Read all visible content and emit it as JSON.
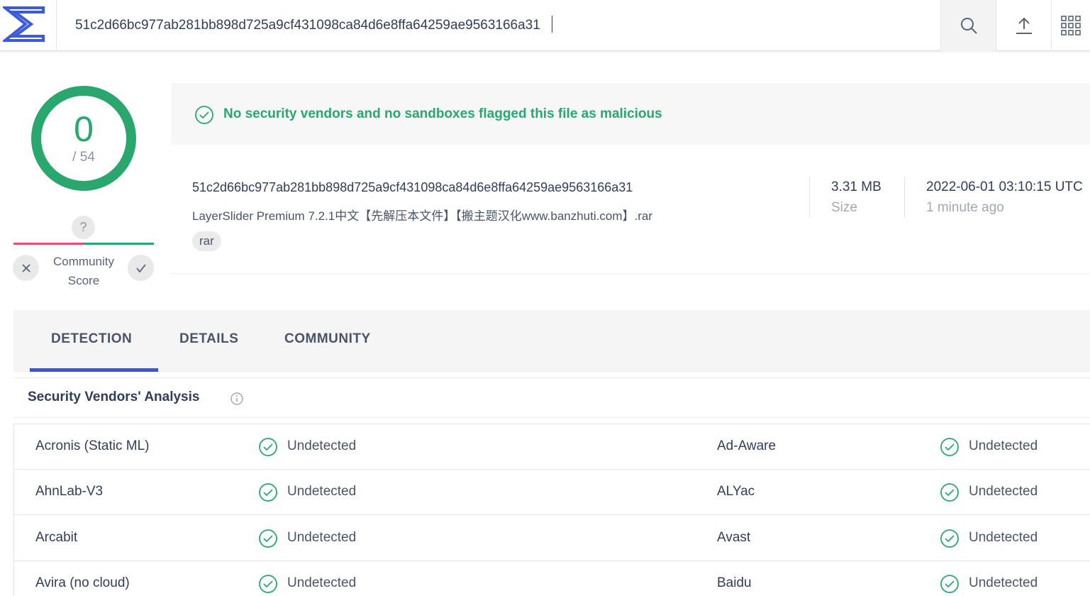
{
  "header": {
    "search_value": "51c2d66bc977ab281bb898d725a9cf431098ca84d6e8ffa64259ae9563166a31",
    "logo_icon": "virustotal-sigma-logo",
    "search_icon": "search-icon",
    "upload_icon": "upload-icon",
    "apps_icon": "apps-grid-icon"
  },
  "score": {
    "detections": "0",
    "total": "/ 54",
    "color": "#2aa76e"
  },
  "community": {
    "question": "?",
    "label_line1": "Community",
    "label_line2": "Score",
    "negative_color": "#e5506e",
    "positive_color": "#2aa76e"
  },
  "banner": {
    "message": "No security vendors and no sandboxes flagged this file as malicious",
    "color": "#2aa76e"
  },
  "file": {
    "hash": "51c2d66bc977ab281bb898d725a9cf431098ca84d6e8ffa64259ae9563166a31",
    "name": "LayerSlider Premium 7.2.1中文【先解压本文件】【搬主题汉化www.banzhuti.com】.rar",
    "tag": "rar",
    "size_value": "3.31 MB",
    "size_label": "Size",
    "date_value": "2022-06-01 03:10:15 UTC",
    "date_relative": "1 minute ago"
  },
  "tabs": [
    {
      "label": "DETECTION",
      "active": true
    },
    {
      "label": "DETAILS",
      "active": false
    },
    {
      "label": "COMMUNITY",
      "active": false
    }
  ],
  "accent_color": "#3f51d6",
  "vendors_section": {
    "title": "Security Vendors' Analysis"
  },
  "vendor_rows": [
    {
      "left_vendor": "Acronis (Static ML)",
      "left_status": "Undetected",
      "right_vendor": "Ad-Aware",
      "right_status": "Undetected"
    },
    {
      "left_vendor": "AhnLab-V3",
      "left_status": "Undetected",
      "right_vendor": "ALYac",
      "right_status": "Undetected"
    },
    {
      "left_vendor": "Arcabit",
      "left_status": "Undetected",
      "right_vendor": "Avast",
      "right_status": "Undetected"
    },
    {
      "left_vendor": "Avira (no cloud)",
      "left_status": "Undetected",
      "right_vendor": "Baidu",
      "right_status": "Undetected"
    }
  ]
}
